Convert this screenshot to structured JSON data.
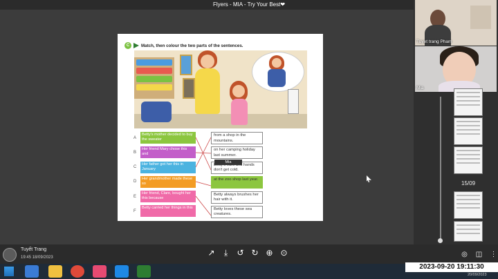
{
  "window": {
    "title": "Flyers - MIA - Try Your Best",
    "heart": "❤"
  },
  "exercise": {
    "badge": "C",
    "instruction": "Match, then colour the two parts of the sentences.",
    "left": [
      {
        "letter": "A",
        "text": "Betty's mother decided to buy the sweater",
        "color": "#8cc63f"
      },
      {
        "letter": "B",
        "text": "Her friend Mary chose this and",
        "color": "#c35ec9"
      },
      {
        "letter": "C",
        "text": "Her father got her this in January",
        "color": "#4bb3e0"
      },
      {
        "letter": "D",
        "text": "Her grandmother made these so",
        "color": "#f39c24"
      },
      {
        "letter": "E",
        "text": "Her friend, Clare, bought her this because",
        "color": "#f06aa8"
      },
      {
        "letter": "F",
        "text": "Betty carried her things in this",
        "color": "#f06aa8"
      }
    ],
    "right": [
      {
        "text": "from a shop in the mountains.",
        "highlight": false
      },
      {
        "text": "on her camping holiday last summer.",
        "highlight": false
      },
      {
        "text": "Betty's ears and hands don't get cold.",
        "highlight": false
      },
      {
        "text": "at the zoo shop last year.",
        "highlight": true
      },
      {
        "text": "Betty always brushes her hair with it.",
        "highlight": false
      },
      {
        "text": "Betty loves these sea creatures.",
        "highlight": false
      }
    ],
    "cursor_label": "Mia"
  },
  "participants": [
    {
      "name": "Tuyet trang Pham"
    },
    {
      "name": "Mia"
    }
  ],
  "sidebar": {
    "date_label": "15/09"
  },
  "footer": {
    "user": "Tuyết Trang",
    "datetime": "19:45 18/09/2023",
    "tools": [
      "redo-arrow",
      "download",
      "undo",
      "redo",
      "zoom-in",
      "fit"
    ]
  },
  "clock": {
    "time": "2023-09-20  19:11:30",
    "date_small": "20/09/2023"
  }
}
